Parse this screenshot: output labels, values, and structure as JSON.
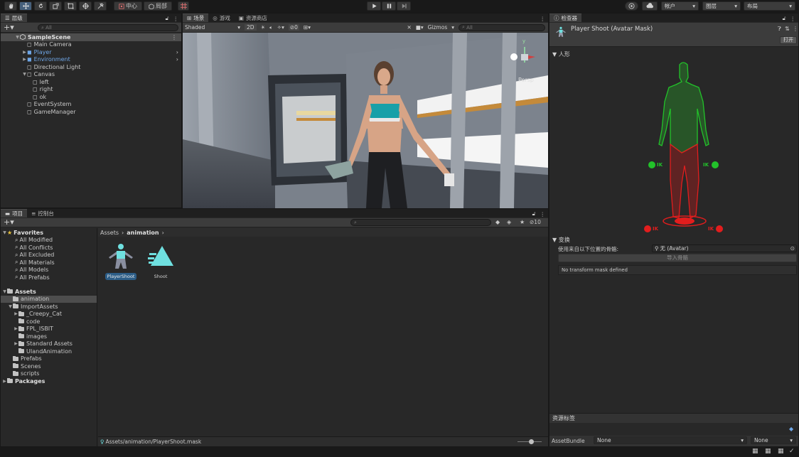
{
  "toolbar": {
    "center_label": "中心",
    "local_label": "局部",
    "account_label": "帐户",
    "layers_label": "图层",
    "layout_label": "布局"
  },
  "hierarchy": {
    "tab_label": "层级",
    "search_placeholder": "All",
    "scene_name": "SampleScene",
    "items": [
      {
        "label": "Main Camera",
        "indent": 1,
        "expandable": false,
        "prefab": false
      },
      {
        "label": "Player",
        "indent": 1,
        "expandable": true,
        "prefab": true
      },
      {
        "label": "Environment",
        "indent": 1,
        "expandable": true,
        "prefab": true
      },
      {
        "label": "Directional Light",
        "indent": 1,
        "expandable": false,
        "prefab": false
      },
      {
        "label": "Canvas",
        "indent": 1,
        "expandable": true,
        "expanded": true,
        "prefab": false
      },
      {
        "label": "left",
        "indent": 2,
        "expandable": false,
        "prefab": false
      },
      {
        "label": "right",
        "indent": 2,
        "expandable": false,
        "prefab": false
      },
      {
        "label": "ok",
        "indent": 2,
        "expandable": false,
        "prefab": false
      },
      {
        "label": "EventSystem",
        "indent": 1,
        "expandable": false,
        "prefab": false
      },
      {
        "label": "GameManager",
        "indent": 1,
        "expandable": false,
        "prefab": false
      }
    ]
  },
  "scene": {
    "tabs": [
      "场景",
      "游戏",
      "资源商店"
    ],
    "shading_mode": "Shaded",
    "mode_2d": "2D",
    "hidden_count": "0",
    "gizmos_label": "Gizmos",
    "search_placeholder": "All",
    "persp_label": "Persp",
    "axis_y": "y"
  },
  "project": {
    "tabs": [
      "项目",
      "控制台"
    ],
    "breadcrumb_root": "Assets",
    "breadcrumb_current": "animation",
    "hidden_count": "10",
    "favorites_label": "Favorites",
    "favorites": [
      "All Modified",
      "All Conflicts",
      "All Excluded",
      "All Materials",
      "All Models",
      "All Prefabs"
    ],
    "assets_label": "Assets",
    "folders": [
      {
        "label": "animation",
        "indent": 1,
        "expandable": false,
        "selected": true
      },
      {
        "label": "ImportAssets",
        "indent": 1,
        "expandable": true,
        "expanded": true
      },
      {
        "label": "_Creepy_Cat",
        "indent": 2,
        "expandable": true
      },
      {
        "label": "code",
        "indent": 2,
        "expandable": false
      },
      {
        "label": "FPL_ISBIT",
        "indent": 2,
        "expandable": true
      },
      {
        "label": "images",
        "indent": 2,
        "expandable": false
      },
      {
        "label": "Standard Assets",
        "indent": 2,
        "expandable": true
      },
      {
        "label": "UIandAnimation",
        "indent": 2,
        "expandable": false
      },
      {
        "label": "Prefabs",
        "indent": 1,
        "expandable": false
      },
      {
        "label": "Scenes",
        "indent": 1,
        "expandable": false
      },
      {
        "label": "scripts",
        "indent": 1,
        "expandable": false
      }
    ],
    "packages_label": "Packages",
    "assets": [
      {
        "label": "PlayerShoot",
        "kind": "avatar-mask"
      },
      {
        "label": "Shoot",
        "kind": "animation-clip"
      }
    ],
    "status_path": "Assets/animation/PlayerShoot.mask"
  },
  "inspector": {
    "tab_label": "检查器",
    "title": "Player Shoot (Avatar Mask)",
    "open_label": "打开",
    "humanoid_section": "人形",
    "ik_label": "IK",
    "transform_section": "变换",
    "use_skeleton_label": "使用来自以下位置的骨骼:",
    "avatar_value": "无 (Avatar)",
    "import_skeleton_label": "导入骨骼",
    "no_mask_text": "No transform mask defined",
    "asset_labels_title": "资源标签",
    "asset_bundle_label": "AssetBundle",
    "asset_bundle_value": "None",
    "asset_variant_value": "None"
  },
  "colors": {
    "accent": "#2c5d87",
    "mask_green": "#22c22a",
    "mask_red": "#e21d1d",
    "prefab_blue": "#6fa7e8"
  }
}
